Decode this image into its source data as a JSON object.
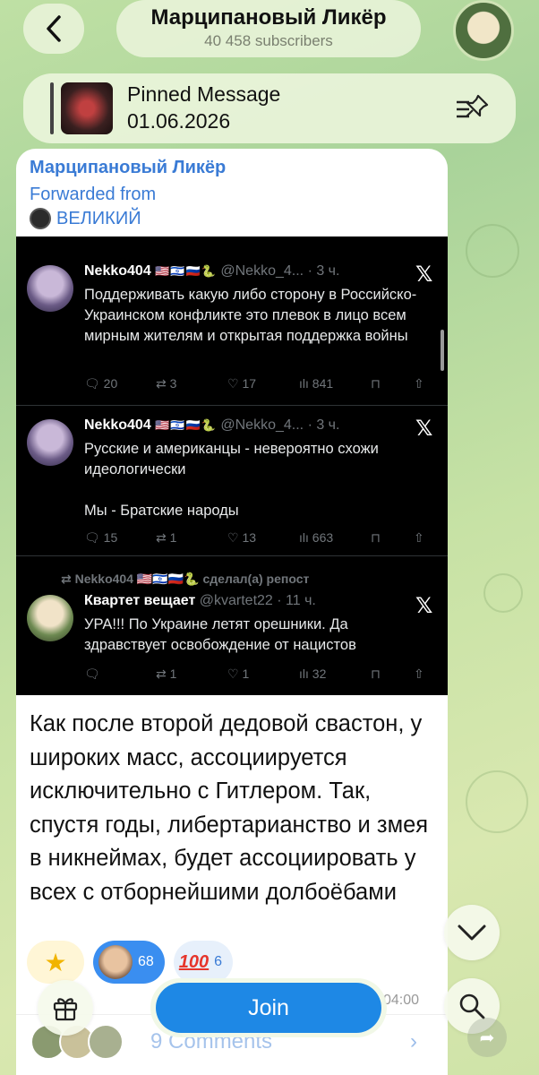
{
  "header": {
    "channel_name": "Марципановый Ликёр",
    "subscribers": "40 458 subscribers"
  },
  "pinned": {
    "title": "Pinned Message",
    "date": "01.06.2026"
  },
  "message": {
    "sender": "Марципановый Ликёр",
    "forwarded_label": "Forwarded from",
    "forwarded_source": "ВЕЛИКИЙ",
    "tweets": [
      {
        "author": "Nekko404",
        "flags": "🇺🇸🇮🇱🇷🇺🐍",
        "handle": "@Nekko_4...",
        "time": "· 3 ч.",
        "text": "Поддерживать какую либо сторону в Российско-Украинском конфликте это плевок в лицо всем мирным жителям и открытая поддержка войны",
        "replies": "20",
        "reposts": "3",
        "likes": "17",
        "views": "841"
      },
      {
        "author": "Nekko404",
        "flags": "🇺🇸🇮🇱🇷🇺🐍",
        "handle": "@Nekko_4...",
        "time": "· 3 ч.",
        "text_line1": "Русские и американцы - невероятно схожи идеологически",
        "text_line2": "Мы - Братские народы",
        "replies": "15",
        "reposts": "1",
        "likes": "13",
        "views": "663"
      },
      {
        "repost_by": "Nekko404 🇺🇸🇮🇱🇷🇺🐍 сделал(а) репост",
        "author": "Квартет вещает",
        "handle": "@kvartet22",
        "time": "· 11 ч.",
        "text": "УРА!!! По Украине летят орешники. Да здравствует освобождение от нацистов",
        "replies": "",
        "reposts": "1",
        "likes": "1",
        "views": "32"
      }
    ],
    "body": "Как после второй дедовой свастон, у широких масс, ассоциируется исключительно с Гитлером. Так, спустя годы, либертарианство и змея в никнеймах, будет ассоциировать у всех с отборнейшими долбоёбами",
    "reactions": [
      {
        "type": "paid-star",
        "icon": "star-icon"
      },
      {
        "type": "custom-face",
        "count": "68"
      },
      {
        "type": "100",
        "emoji": "100",
        "count": "6"
      }
    ],
    "time": "04:00",
    "comments_label": "9 Comments"
  },
  "bottom": {
    "join_label": "Join"
  },
  "colors": {
    "accent": "#3a7bd5",
    "join": "#1e88e5",
    "tweet_bg": "#000000"
  }
}
